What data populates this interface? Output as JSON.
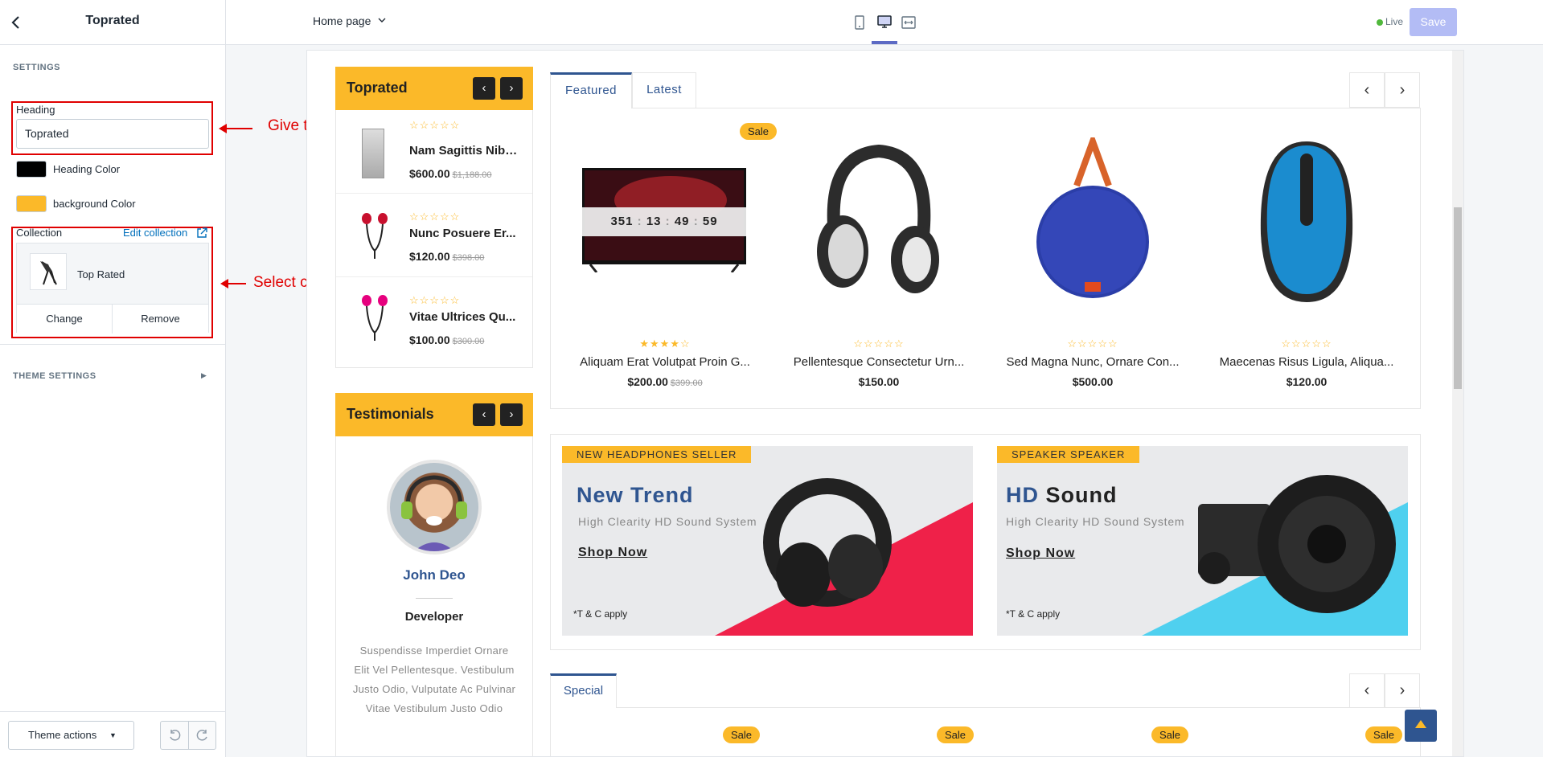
{
  "sidebar": {
    "title": "Toprated",
    "settings_label": "SETTINGS",
    "heading_label": "Heading",
    "heading_value": "Toprated",
    "heading_color_label": "Heading Color",
    "heading_color": "#000000",
    "bg_color_label": "background Color",
    "bg_color": "#fbb929",
    "collection_label": "Collection",
    "edit_collection": "Edit collection",
    "collection_name": "Top Rated",
    "change_label": "Change",
    "remove_label": "Remove",
    "theme_settings": "THEME SETTINGS",
    "theme_actions": "Theme actions"
  },
  "annotations": {
    "heading_note": "Give the heading of your product",
    "collection_note": "Select collection for toprated"
  },
  "topbar": {
    "page_select": "Home page",
    "live_label": "Live",
    "save_label": "Save",
    "accent": "#5c6ac4"
  },
  "toprated": {
    "title": "Toprated",
    "items": [
      {
        "name": "Nam Sagittis Nibh...",
        "price": "$600.00",
        "old": "$1,188.00"
      },
      {
        "name": "Nunc Posuere Er...",
        "price": "$120.00",
        "old": "$398.00"
      },
      {
        "name": "Vitae Ultrices Qu...",
        "price": "$100.00",
        "old": "$300.00"
      }
    ]
  },
  "testimonials": {
    "title": "Testimonials",
    "name": "John Deo",
    "role": "Developer",
    "text": "Suspendisse Imperdiet Ornare Elit Vel Pellentesque. Vestibulum Justo Odio, Vulputate Ac Pulvinar Vitae Vestibulum Justo Odio"
  },
  "tabs": {
    "featured": "Featured",
    "latest": "Latest",
    "special": "Special"
  },
  "countdown": {
    "d": "351",
    "h": "13",
    "m": "49",
    "s": "59"
  },
  "products": [
    {
      "name": "Aliquam Erat Volutpat Proin G...",
      "price": "$200.00",
      "old": "$399.00",
      "sale": "Sale",
      "rating": 4
    },
    {
      "name": "Pellentesque Consectetur Urn...",
      "price": "$150.00",
      "old": "",
      "sale": "",
      "rating": 0
    },
    {
      "name": "Sed Magna Nunc, Ornare Con...",
      "price": "$500.00",
      "old": "",
      "sale": "",
      "rating": 0
    },
    {
      "name": "Maecenas Risus Ligula, Aliqua...",
      "price": "$120.00",
      "old": "",
      "sale": "",
      "rating": 0
    }
  ],
  "banners": [
    {
      "tag": "NEW HEADPHONES SELLER",
      "title_a": "New Trend",
      "title_b": "",
      "sub": "High Clearity HD Sound System",
      "cta": "Shop Now",
      "note": "*T & C apply"
    },
    {
      "tag": "SPEAKER SPEAKER",
      "title_a": "HD",
      "title_b": "Sound",
      "sub": "High Clearity HD Sound System",
      "cta": "Shop Now",
      "note": "*T & C apply"
    }
  ],
  "sale_label": "Sale"
}
